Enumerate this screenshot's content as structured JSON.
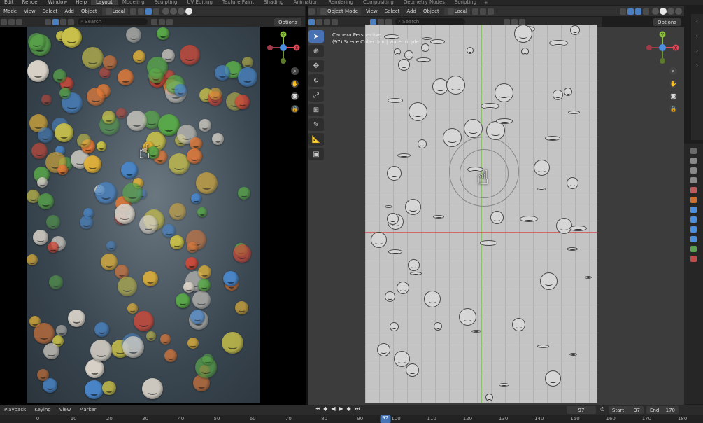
{
  "topbar": {
    "menus": [
      "Edit",
      "Render",
      "Window",
      "Help"
    ],
    "workspaces": [
      "Layout",
      "Modeling",
      "Sculpting",
      "UV Editing",
      "Texture Paint",
      "Shading",
      "Animation",
      "Rendering",
      "Compositing",
      "Geometry Nodes",
      "Scripting"
    ],
    "active_workspace": "Layout",
    "add_label": "+"
  },
  "left_header": {
    "mode": "Mode",
    "menus": [
      "View",
      "Select",
      "Add",
      "Object"
    ],
    "transform": "Local",
    "search_placeholder": "Search",
    "options": "Options"
  },
  "right_header": {
    "mode": "Object Mode",
    "menus": [
      "View",
      "Select",
      "Add",
      "Object"
    ],
    "transform": "Local",
    "search_placeholder": "Search",
    "options": "Options"
  },
  "viewport_info": {
    "line1": "Camera Perspective",
    "line2": "(97) Scene Collection | water ripple"
  },
  "gizmo": {
    "x": "X",
    "y": "Y",
    "z": "Z"
  },
  "timeline": {
    "menus": [
      "Playback",
      "Keying",
      "View",
      "Marker"
    ],
    "current_frame": "97",
    "start_label": "Start",
    "start": "37",
    "end_label": "End",
    "end": "170"
  },
  "ruler": {
    "ticks": [
      "0",
      "10",
      "20",
      "30",
      "40",
      "50",
      "60",
      "70",
      "80",
      "90",
      "100",
      "110",
      "120",
      "130",
      "140",
      "150",
      "160",
      "170",
      "180"
    ],
    "current": "97"
  },
  "colors": {
    "accent": "#4772b3",
    "gizmo_x": "#e04a5a",
    "gizmo_y": "#8cc03c",
    "gizmo_z": "#4a8fe0"
  }
}
